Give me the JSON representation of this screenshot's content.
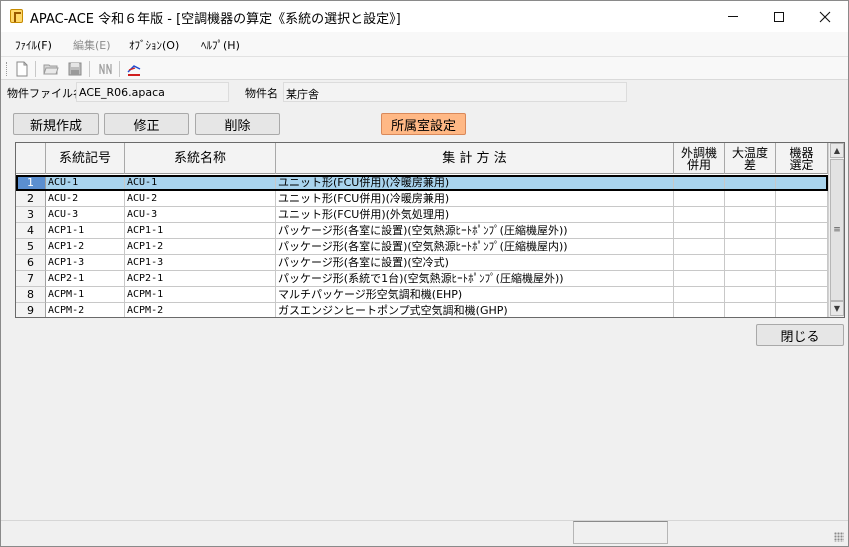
{
  "window": {
    "title": "APAC-ACE 令和６年版 - [空調機器の算定《系統の選択と設定》]"
  },
  "menu": [
    {
      "label": "ﾌｧｲﾙ(F)",
      "enabled": true
    },
    {
      "label": "編集(E)",
      "enabled": false
    },
    {
      "label": "ｵﾌﾞｼｮﾝ(O)",
      "enabled": true
    },
    {
      "label": "ﾍﾙﾌﾟ(H)",
      "enabled": true
    }
  ],
  "toolbar": {
    "icons": [
      "new-file-icon",
      "open-folder-icon",
      "save-icon",
      "vertical-label-icon",
      "chart-tool-icon"
    ]
  },
  "info": {
    "file_label": "物件ファイル名",
    "file_value": "ACE_R06.apaca",
    "property_label": "物件名",
    "property_value": "某庁舎"
  },
  "actions": {
    "new_label": "新規作成",
    "edit_label": "修正",
    "delete_label": "削除",
    "room_label": "所属室設定",
    "close_label": "閉じる"
  },
  "grid": {
    "headers": {
      "code": "系統記号",
      "name": "系統名称",
      "method": "集 計 方 法",
      "outdoor_1": "外調機",
      "outdoor_2": "併用",
      "temp_1": "大温度",
      "temp_2": "差",
      "equip_1": "機器",
      "equip_2": "選定"
    },
    "rows": [
      {
        "no": "1",
        "code": "ACU-1",
        "name": "ACU-1",
        "method": "ユニット形(FCU併用)(冷暖房兼用)",
        "outdoor": "",
        "temp": "",
        "equip": ""
      },
      {
        "no": "2",
        "code": "ACU-2",
        "name": "ACU-2",
        "method": "ユニット形(FCU併用)(冷暖房兼用)",
        "outdoor": "",
        "temp": "",
        "equip": ""
      },
      {
        "no": "3",
        "code": "ACU-3",
        "name": "ACU-3",
        "method": "ユニット形(FCU併用)(外気処理用)",
        "outdoor": "",
        "temp": "",
        "equip": ""
      },
      {
        "no": "4",
        "code": "ACP1-1",
        "name": "ACP1-1",
        "method": "パッケージ形(各室に設置)(空気熱源ﾋｰﾄﾎﾟﾝﾌﾟ(圧縮機屋外))",
        "outdoor": "",
        "temp": "",
        "equip": ""
      },
      {
        "no": "5",
        "code": "ACP1-2",
        "name": "ACP1-2",
        "method": "パッケージ形(各室に設置)(空気熱源ﾋｰﾄﾎﾟﾝﾌﾟ(圧縮機屋内))",
        "outdoor": "",
        "temp": "",
        "equip": ""
      },
      {
        "no": "6",
        "code": "ACP1-3",
        "name": "ACP1-3",
        "method": "パッケージ形(各室に設置)(空冷式)",
        "outdoor": "",
        "temp": "",
        "equip": ""
      },
      {
        "no": "7",
        "code": "ACP2-1",
        "name": "ACP2-1",
        "method": "パッケージ形(系統で1台)(空気熱源ﾋｰﾄﾎﾟﾝﾌﾟ(圧縮機屋外))",
        "outdoor": "",
        "temp": "",
        "equip": ""
      },
      {
        "no": "8",
        "code": "ACPM-1",
        "name": "ACPM-1",
        "method": "マルチパッケージ形空気調和機(EHP)",
        "outdoor": "",
        "temp": "",
        "equip": ""
      },
      {
        "no": "9",
        "code": "ACPM-2",
        "name": "ACPM-2",
        "method": "ガスエンジンヒートポンプ式空気調和機(GHP)",
        "outdoor": "",
        "temp": "",
        "equip": ""
      }
    ],
    "selected_row": "1"
  },
  "status": {
    "pane_text": ""
  },
  "colors": {
    "selected_row": "#a9d4ee",
    "selected_rownum": "#5b8fd0",
    "room_button": "#ffb885"
  }
}
